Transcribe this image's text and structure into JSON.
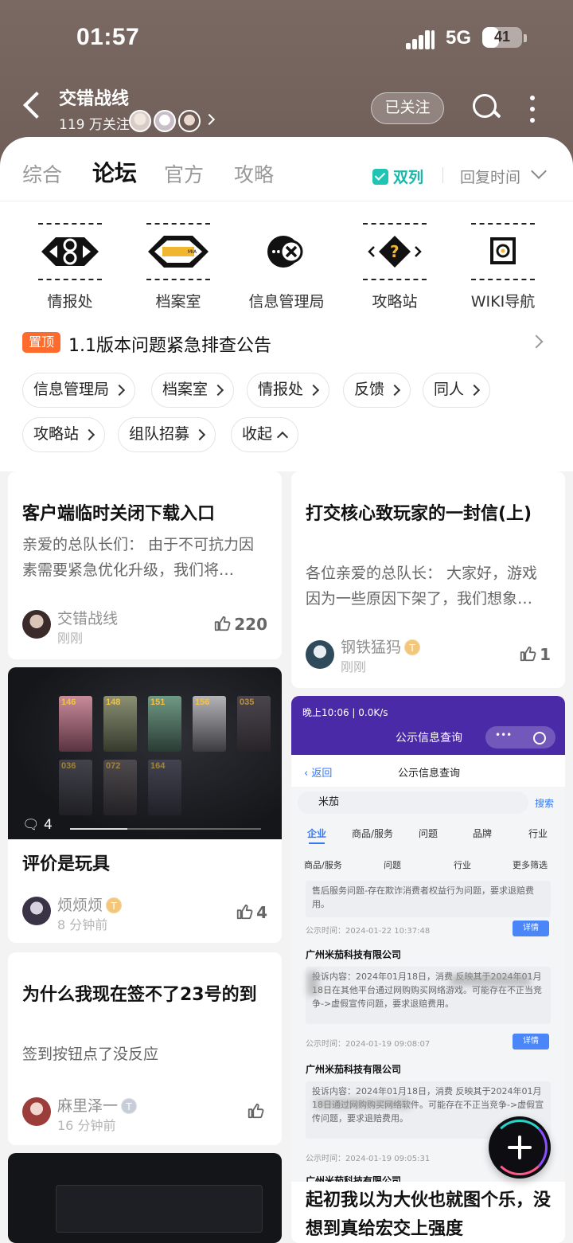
{
  "status_bar": {
    "time": "01:57",
    "network": "5G",
    "battery": "41",
    "battery_level": 0.41
  },
  "header": {
    "title": "交错战线",
    "followers": "119 万关注",
    "follow_button": "已关注"
  },
  "tabs": [
    "综合",
    "论坛",
    "官方",
    "攻略"
  ],
  "active_tab": "论坛",
  "dual_column": "双列",
  "sort_label": "回复时间",
  "categories": [
    "情报处",
    "档案室",
    "信息管理局",
    "攻略站",
    "WIKI导航"
  ],
  "pinned": {
    "tag": "置顶",
    "text": "1.1版本问题紧急排查公告"
  },
  "chips": [
    "信息管理局",
    "档案室",
    "情报处",
    "反馈",
    "同人",
    "攻略站",
    "组队招募",
    "收起"
  ],
  "posts": [
    {
      "title": "客户端临时关闭下载入口",
      "desc": "亲爱的总队长们： 由于不可抗力因素需要紧急优化升级，我们将…",
      "author": "交错战线",
      "time": "刚刚",
      "likes": "220"
    },
    {
      "title": "打交核心致玩家的一封信(上)",
      "desc": "各位亲爱的总队长： 大家好，游戏因为一些原因下架了，我们想象…",
      "author": "钢铁猛犸",
      "time": "刚刚",
      "likes": "1"
    },
    {
      "title": "评价是玩具",
      "author": "烦烦烦",
      "time": "8 分钟前",
      "likes": "4",
      "comments": "4",
      "tile_levels": [
        "146",
        "148",
        "151",
        "156",
        "035",
        "036",
        "072",
        "164"
      ]
    },
    {
      "title": "为什么我现在签不了23号的到",
      "desc": "签到按钮点了没反应",
      "author": "麻里泽一",
      "time": "16 分钟前"
    },
    {
      "title": "起初我以为大伙也就图个乐，没想到真给宏交上强度"
    }
  ],
  "screenshot_post": {
    "status": "晚上10:06 | 0.0K/s",
    "app_title": "公示信息查询",
    "back": "返回",
    "nav_title": "公示信息查询",
    "search_value": "米茄",
    "search_btn": "搜索",
    "tabs": [
      "企业",
      "商品/服务",
      "问题",
      "品牌",
      "行业"
    ],
    "filters": [
      "商品/服务",
      "问题",
      "行业",
      "更多筛选"
    ],
    "block1": "售后服务问题-存在欺诈消费者权益行为问题，要求退赔费用。",
    "date1": "公示时间：2024-01-22 10:37:48",
    "company": "广州米茄科技有限公司",
    "block2": "投诉内容：2024年01月18日，消费 反映其于2024年01月18日在其他平台通过网购购买网络游戏。可能存在不正当竞争->虚假宣传问题，要求退赔费用。",
    "date2": "公示时间：2024-01-19 09:08:07",
    "block3": "投诉内容：2024年01月18日，消费 反映其于2024年01月18日通过网购购买网络软件。可能存在不正当竞争->虚假宣传问题，要求退赔费用。",
    "date3": "公示时间：2024-01-19 09:05:31",
    "detail": "详情"
  }
}
